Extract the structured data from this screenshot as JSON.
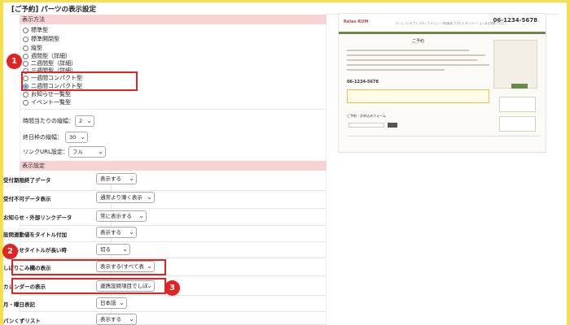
{
  "page_title": "[ご予約] パーツの表示設定",
  "sections": {
    "display_method": "表示方法",
    "display_settings": "表示設定"
  },
  "radio_options": [
    {
      "label": "標準型",
      "checked": false
    },
    {
      "label": "標準開閉型",
      "checked": false
    },
    {
      "label": "縦型",
      "checked": false
    },
    {
      "label": "週間型（詳細）",
      "checked": false
    },
    {
      "label": "二週間型（詳細）",
      "checked": false
    },
    {
      "label": "三週間型（詳細）",
      "checked": false
    },
    {
      "label": "一週間コンパクト型",
      "checked": false
    },
    {
      "label": "二週間コンパクト型",
      "checked": true
    },
    {
      "label": "お知らせ一覧型",
      "checked": false
    },
    {
      "label": "イベント一覧型",
      "checked": false
    }
  ],
  "settings": [
    {
      "label": "時間当たりの縦幅：",
      "value": "2"
    },
    {
      "label": "終日枠の縦幅：",
      "value": "30"
    },
    {
      "label": "リンクURL設定：",
      "value": "フル"
    }
  ],
  "table_rows": [
    {
      "label": "受付期限終了データ",
      "value": "表示する"
    },
    {
      "label": "受付不可データ表示",
      "value": "通常より薄く表示"
    },
    {
      "label": "お知らせ・外部リンクデータ",
      "value": "常に表示する"
    },
    {
      "label": "設問連動値をタイトル付加",
      "value": "表示する"
    },
    {
      "label": "お知らせタイトルが長い時",
      "value": "切る"
    },
    {
      "label": "しぼりこみ欄の表示",
      "value": "表示する(すべて表"
    },
    {
      "label": "カレンダーの表示",
      "value": "連携設問項目でしぼ"
    },
    {
      "label": "月・曜日表記",
      "value": "日本語"
    },
    {
      "label": "パンくずリスト",
      "value": "表示する"
    }
  ],
  "badges": [
    "1",
    "2",
    "3"
  ],
  "preview": {
    "logo": "Relax RUM",
    "nav": "ホーム  コンセプト  スタッフ  メニュー  予約案内  アクセス  ギャラリー  よくある質問  ブログ",
    "phone": "06-1234-5678",
    "title": "ご予約",
    "phone_inline": "06-1234-5678",
    "form_title": "ご予約・お申込みフォーム",
    "reserve_button": "ご予約"
  },
  "colors": {
    "frame": "#f5df4e",
    "section_bg": "#f8d3d3",
    "highlight": "#e02424",
    "radio_checked": "#3a78d6"
  }
}
